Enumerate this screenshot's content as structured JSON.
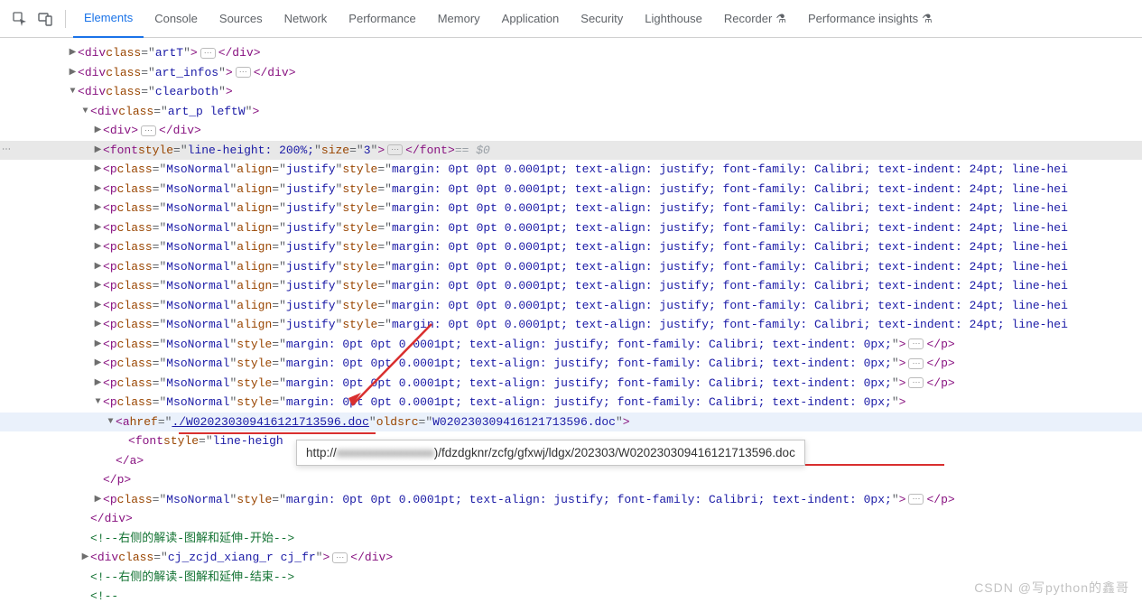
{
  "tabs": {
    "elements": "Elements",
    "console": "Console",
    "sources": "Sources",
    "network": "Network",
    "performance": "Performance",
    "memory": "Memory",
    "application": "Application",
    "security": "Security",
    "lighthouse": "Lighthouse",
    "recorder": "Recorder",
    "insights": "Performance insights"
  },
  "dom": {
    "artT": {
      "cls": "artT"
    },
    "art_infos": {
      "cls": "art_infos"
    },
    "clearboth": {
      "cls": "clearboth"
    },
    "art_p": {
      "cls": "art_p leftW"
    },
    "font_style": "line-height: 200%;",
    "font_size": "3",
    "eq": "== $0",
    "p_justify": {
      "cls": "MsoNormal",
      "align": "justify",
      "style": "margin: 0pt 0pt 0.0001pt; text-align: justify; font-family: Calibri; text-indent: 24pt; line-hei"
    },
    "p_plain": {
      "cls": "MsoNormal",
      "style": "margin: 0pt 0pt 0.0001pt; text-align: justify; font-family: Calibri; text-indent: 0px;"
    },
    "a_href": "./W020230309416121713596.doc",
    "a_oldsrc": "W020230309416121713596.doc",
    "font_inner": "line-heigh",
    "comment_open": "右侧的解读-图解和延伸-开始",
    "cj_cls": "cj_zcjd_xiang_r cj_fr",
    "comment_close": "右侧的解读-图解和延伸-结束",
    "comment_bottom": "     "
  },
  "tooltip": {
    "prefix": "http://",
    "blurred": "xxxxxxxxxxxxxxxx",
    "suffix": ")/fdzdgknr/zcfg/gfxwj/ldgx/202303/W020230309416121713596.doc"
  },
  "watermark": "CSDN @写python的鑫哥"
}
